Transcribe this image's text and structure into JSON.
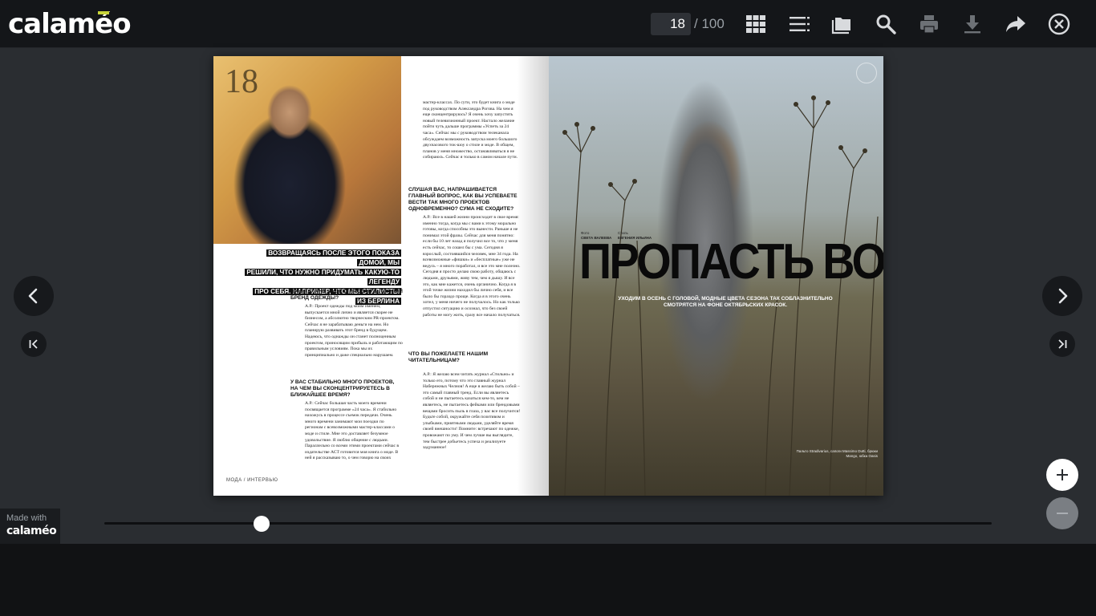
{
  "app": {
    "logo_text": "calaméo",
    "page_input_value": "18",
    "page_total": "/ 100"
  },
  "toolbar": {
    "icons": [
      "grid-icon",
      "list-icon",
      "folder-icon",
      "search-icon",
      "print-icon",
      "download-icon",
      "share-icon",
      "close-icon"
    ]
  },
  "left_page": {
    "page_number": "18",
    "quote_lines": [
      "ВОЗВРАЩАЯСЬ ПОСЛЕ ЭТОГО ПОКАЗА ДОМОЙ, МЫ",
      "РЕШИЛИ, ЧТО НУЖНО ПРИДУМАТЬ КАКУЮ-ТО ЛЕГЕНДУ",
      "ПРО СЕБЯ. НАПРИМЕР, ЧТО МЫ СТИЛИСТЫ ИЗ БЕРЛИНА"
    ],
    "col1": [
      {
        "question": "ВАШ ТАЛАНТ ИНВЕСТИРОВАН В ЛИЧНЫЙ БРЕНД ОДЕЖДЫ?",
        "answer": "А.Р.: Проект одежды под моим именем, выпускается мной лично и является скорее не бизнесом, а абсолютно творческим PR-проектом. Сейчас я не зарабатываю деньги на нем. Но планирую развивать этот бренд в будущем. Надеюсь, что однажды он станет полноценным проектом, приносящим прибыль и работающим по правильным условиям. Пока мы их принципиально и даже специально нарушаем."
      },
      {
        "question": "У ВАС СТАБИЛЬНО МНОГО ПРОЕКТОВ, НА ЧЕМ ВЫ СКОНЦЕНТРИРУЕТЕСЬ В БЛИЖАЙШЕЕ ВРЕМЯ?",
        "answer": "А.Р.: Сейчас большая часть моего времени посвящается программе «24 часа». Я стабильно нахожусь в процессе съемок передачи. Очень много времени занимают мои поездки по регионам с всевозможными мастер-классами о моде и стиле. Мне это доставляет безумное удовольствие. Я люблю общение с людьми. Параллельно со всеми этими проектами сейчас в издательстве АСТ готовится моя книга о моде. В ней я рассказываю то, о чем говорю на своих"
      }
    ],
    "col2": [
      {
        "question": "",
        "answer": "мастер-классах. По сути, это будет книга о моде под руководством Александра Рогова. На чем я еще сконцентрируюсь? Я очень хочу запустить новый телевизионный проект. Настало желание пойти чуть дальше программы «Успеть за 24 часа». Сейчас мы с руководством телеканала обсуждаем возможность запуска моего большого двухчасового ток-шоу о стиле и моде. В общем, планов у меня множество, останавливаться я не собираюсь. Сейчас я только в самом начале пути."
      },
      {
        "question": "СЛУШАЯ ВАС, НАПРАШИВАЕТСЯ ГЛАВНЫЙ ВОПРОС, КАК ВЫ УСПЕВАЕТЕ ВЕСТИ ТАК МНОГО ПРОЕКТОВ ОДНОВРЕМЕННО? СУМА НЕ СХОДИТЕ?",
        "answer": "А.Р.: Все в нашей жизни происходит в свое время: именно тогда, когда мы с вами к этому морально готовы, когда способны это вынести. Раньше я не понимал этой фразы. Сейчас для меня понятно: если бы 10 лет назад я получил все то, что у меня есть сейчас, то сошел бы с ума. Сегодня я взрослый, состоявшийся человек, мне 34 года. На всевозможные «фишки» и «бесплатные» уже не ведусь – я много поработал, и все это мне полезно. Сегодня я просто делаю свою работу, общаюсь с людьми, друзьями, живу тем, чем я дышу. И все это, как мне кажется, очень органично. Когда я в этой точке жизни находил бы лично себя, и все было бы гораздо проще. Когда я в этого очень хотел, у меня ничего не получалось. Но как только отпустил ситуацию и осознал, что без своей работы не могу жить, сразу все начало получаться."
      },
      {
        "question": "ЧТО ВЫ ПОЖЕЛАЕТЕ НАШИМ ЧИТАТЕЛЬНИЦАМ?",
        "answer": "А.Р.: Я желаю всем читать журнал «Стильно» и только его, потому что это главный журнал Набережных Челнов! А еще я желаю быть собой – это самый главный тренд. Если вы являетесь собой и не пытаетесь казаться кем-то, кем не являетесь, не пытаетесь фейками или брендовыми вещами бросить пыль в глаза, у вас все получится! Будьте собой, окружайте себя позитивом и улыбками, приятными людьми, уделяйте время своей внешности! Помните: встречают по одежке, провожают по уму. И чем лучше вы выглядите, тем быстрее добьетесь успеха и реализуете задуманное!"
      }
    ],
    "footer": "МОДА  /  ИНТЕРВЬЮ"
  },
  "right_page": {
    "title": "ПРОПАСТЬ ВО РЖИ",
    "subtitle": "УХОДИМ В ОСЕНЬ С ГОЛОВОЙ, МОДНЫЕ ЦВЕТА СЕЗОНА ТАК СОБЛАЗНИТЕЛЬНО СМОТРЯТСЯ НА ФОНЕ ОКТЯБРЬСКИХ КРАСОК.",
    "credit1_label": "Фото",
    "credit1_name": "СВЕТА ВАЛЕЕВА",
    "credit2_label": "Стиль",
    "credit2_name": "ЕВГЕНИЯ ИЛЬИНА",
    "caption": "Пальто Stradivarius, сапоги Massimo Dutti, брюки Mango, юбка Oasis"
  },
  "footer_badge": {
    "line1": "Made with",
    "line2": "calaméo"
  },
  "slider": {
    "current_page": 18,
    "total_pages": 100
  }
}
